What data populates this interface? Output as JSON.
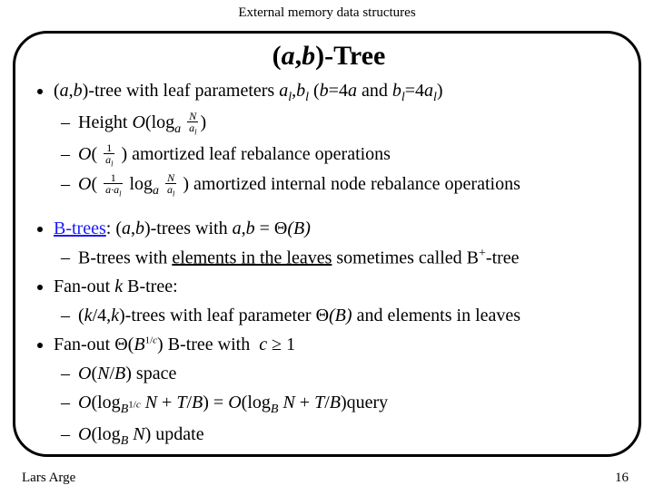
{
  "header": "External memory data structures",
  "title_pre": "(",
  "title_a": "a",
  "title_mid": ",",
  "title_b": "b",
  "title_post": ")-Tree",
  "p1": {
    "pre": "(",
    "a": "a",
    "c1": ",",
    "b": "b",
    "post": ")-tree with leaf parameters ",
    "al": "a",
    "l1": "l",
    "c2": ",",
    "bl": "b",
    "l2": "l",
    "open": " (",
    "b2": "b",
    "eq1": "=4",
    "a2": "a",
    "and": " and ",
    "bl2": "b",
    "l3": "l",
    "eq2": "=4",
    "al2": "a",
    "l4": "l",
    "close": ")"
  },
  "s1": {
    "h": "Height",
    "amL": " amortized leaf rebalance operations",
    "amI": " amortized internal node rebalance operations"
  },
  "bt": {
    "lbl": "B-trees",
    "mid": ": (",
    "a": "a",
    "c": ",",
    "b": "b",
    "post": ")-trees with ",
    "ab": "a",
    "c2": ",",
    "b2": "b",
    "eq": " = "
  },
  "bt1": {
    "pre": "B-trees with ",
    "u": "elements in the leaves",
    "mid": " sometimes called B",
    "plus": "+",
    "post": "-tree"
  },
  "fo": {
    "pre": "Fan-out ",
    "k": "k",
    "post": " B-tree:"
  },
  "fo1": {
    "pre": "(",
    "k": "k",
    "mid": "/4,",
    "k2": "k",
    "post": ")-trees with leaf parameter ",
    "tail": " and elements in leaves"
  },
  "fc": {
    "pre": "Fan-out ",
    "post": " B-tree with"
  },
  "sp": {
    "o": "O",
    "n": "N",
    "b": "B",
    "lbl": " space"
  },
  "q": "query",
  "up": " update",
  "math": {
    "O": "O",
    "log": "log",
    "logB": "log",
    "N": "N",
    "T": "T",
    "B": "B",
    "Th": "Θ",
    "thB": "(B)",
    "thB2": "(B)",
    "c": "c",
    "ge": " ≥ 1"
  },
  "footer": {
    "author": "Lars Arge",
    "page": "16"
  }
}
